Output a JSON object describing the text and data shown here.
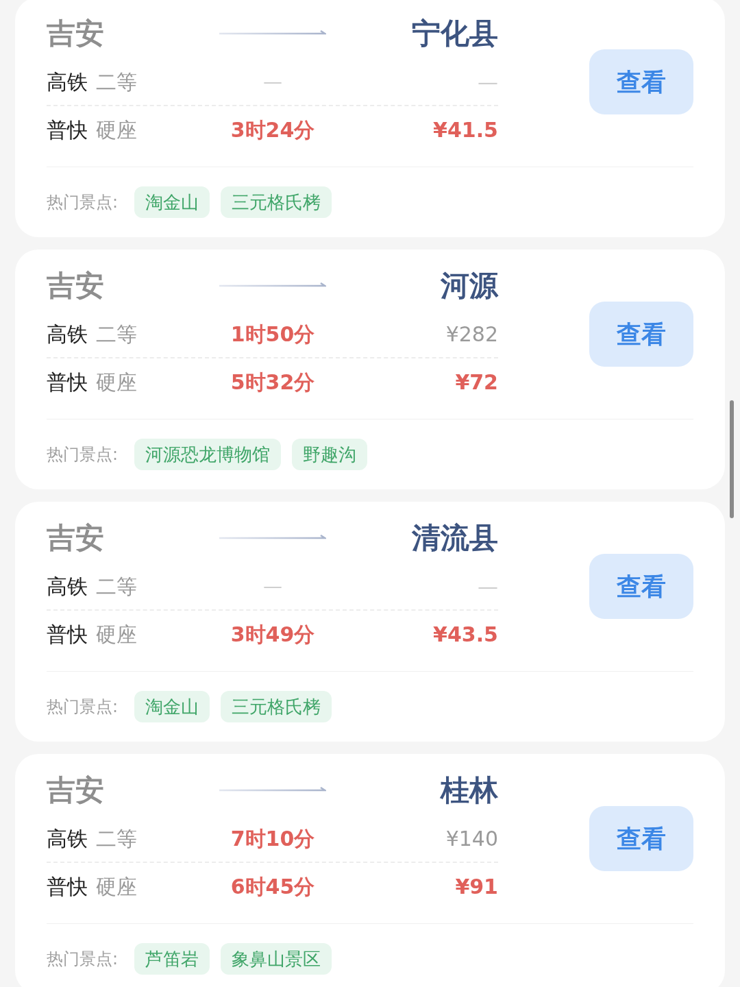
{
  "routes": [
    {
      "origin": "吉安",
      "destination": "宁化县",
      "button": "查看",
      "trains": [
        {
          "kind": "gaotie",
          "type": "高铁",
          "seat": "二等",
          "duration": "—",
          "price": "—"
        },
        {
          "kind": "pukuai",
          "type": "普快",
          "seat": "硬座",
          "duration": "3时24分",
          "price": "¥41.5"
        }
      ],
      "spots_label": "热门景点:",
      "spots": [
        "淘金山",
        "三元格氏栲"
      ]
    },
    {
      "origin": "吉安",
      "destination": "河源",
      "button": "查看",
      "trains": [
        {
          "kind": "gaotie",
          "type": "高铁",
          "seat": "二等",
          "duration": "1时50分",
          "price": "¥282"
        },
        {
          "kind": "pukuai",
          "type": "普快",
          "seat": "硬座",
          "duration": "5时32分",
          "price": "¥72"
        }
      ],
      "spots_label": "热门景点:",
      "spots": [
        "河源恐龙博物馆",
        "野趣沟"
      ]
    },
    {
      "origin": "吉安",
      "destination": "清流县",
      "button": "查看",
      "trains": [
        {
          "kind": "gaotie",
          "type": "高铁",
          "seat": "二等",
          "duration": "—",
          "price": "—"
        },
        {
          "kind": "pukuai",
          "type": "普快",
          "seat": "硬座",
          "duration": "3时49分",
          "price": "¥43.5"
        }
      ],
      "spots_label": "热门景点:",
      "spots": [
        "淘金山",
        "三元格氏栲"
      ]
    },
    {
      "origin": "吉安",
      "destination": "桂林",
      "button": "查看",
      "trains": [
        {
          "kind": "gaotie",
          "type": "高铁",
          "seat": "二等",
          "duration": "7时10分",
          "price": "¥140"
        },
        {
          "kind": "pukuai",
          "type": "普快",
          "seat": "硬座",
          "duration": "6时45分",
          "price": "¥91"
        }
      ],
      "spots_label": "热门景点:",
      "spots": [
        "芦笛岩",
        "象鼻山景区"
      ]
    }
  ]
}
